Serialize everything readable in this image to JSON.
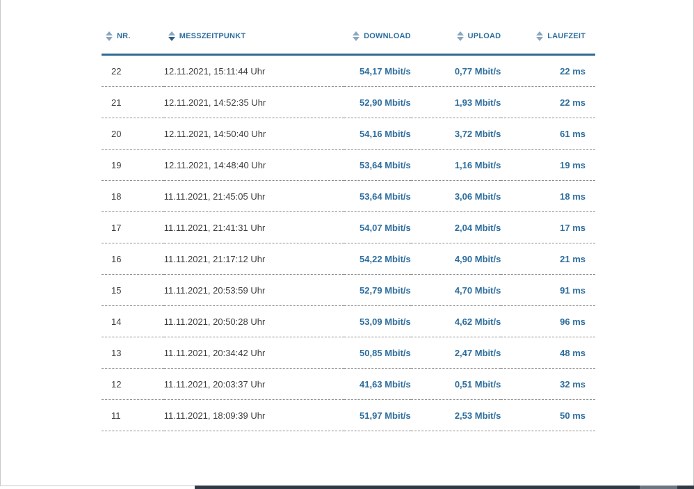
{
  "table": {
    "columns": [
      {
        "key": "nr",
        "label": "NR."
      },
      {
        "key": "timestamp",
        "label": "MESSZEITPUNKT"
      },
      {
        "key": "download",
        "label": "DOWNLOAD"
      },
      {
        "key": "upload",
        "label": "UPLOAD"
      },
      {
        "key": "latency",
        "label": "LAUFZEIT"
      }
    ],
    "rows": [
      {
        "nr": "22",
        "timestamp": "12.11.2021, 15:11:44 Uhr",
        "download": "54,17 Mbit/s",
        "upload": "0,77 Mbit/s",
        "latency": "22 ms"
      },
      {
        "nr": "21",
        "timestamp": "12.11.2021, 14:52:35 Uhr",
        "download": "52,90 Mbit/s",
        "upload": "1,93 Mbit/s",
        "latency": "22 ms"
      },
      {
        "nr": "20",
        "timestamp": "12.11.2021, 14:50:40 Uhr",
        "download": "54,16 Mbit/s",
        "upload": "3,72 Mbit/s",
        "latency": "61 ms"
      },
      {
        "nr": "19",
        "timestamp": "12.11.2021, 14:48:40 Uhr",
        "download": "53,64 Mbit/s",
        "upload": "1,16 Mbit/s",
        "latency": "19 ms"
      },
      {
        "nr": "18",
        "timestamp": "11.11.2021, 21:45:05 Uhr",
        "download": "53,64 Mbit/s",
        "upload": "3,06 Mbit/s",
        "latency": "18 ms"
      },
      {
        "nr": "17",
        "timestamp": "11.11.2021, 21:41:31 Uhr",
        "download": "54,07 Mbit/s",
        "upload": "2,04 Mbit/s",
        "latency": "17 ms"
      },
      {
        "nr": "16",
        "timestamp": "11.11.2021, 21:17:12 Uhr",
        "download": "54,22 Mbit/s",
        "upload": "4,90 Mbit/s",
        "latency": "21 ms"
      },
      {
        "nr": "15",
        "timestamp": "11.11.2021, 20:53:59 Uhr",
        "download": "52,79 Mbit/s",
        "upload": "4,70 Mbit/s",
        "latency": "91 ms"
      },
      {
        "nr": "14",
        "timestamp": "11.11.2021, 20:50:28 Uhr",
        "download": "53,09 Mbit/s",
        "upload": "4,62 Mbit/s",
        "latency": "96 ms"
      },
      {
        "nr": "13",
        "timestamp": "11.11.2021, 20:34:42 Uhr",
        "download": "50,85 Mbit/s",
        "upload": "2,47 Mbit/s",
        "latency": "48 ms"
      },
      {
        "nr": "12",
        "timestamp": "11.11.2021, 20:03:37 Uhr",
        "download": "41,63 Mbit/s",
        "upload": "0,51 Mbit/s",
        "latency": "32 ms"
      },
      {
        "nr": "11",
        "timestamp": "11.11.2021, 18:09:39 Uhr",
        "download": "51,97 Mbit/s",
        "upload": "2,53 Mbit/s",
        "latency": "50 ms"
      }
    ]
  },
  "icons": {
    "sort": "sort-icon",
    "sort_descending_active": "sort-desc-icon"
  },
  "colors": {
    "accent": "#2e6e9e",
    "header_rule": "#2f6a92",
    "text": "#3d3d3d",
    "sort_icon": "#8aa6bd",
    "sort_icon_active": "#2f5f86"
  }
}
